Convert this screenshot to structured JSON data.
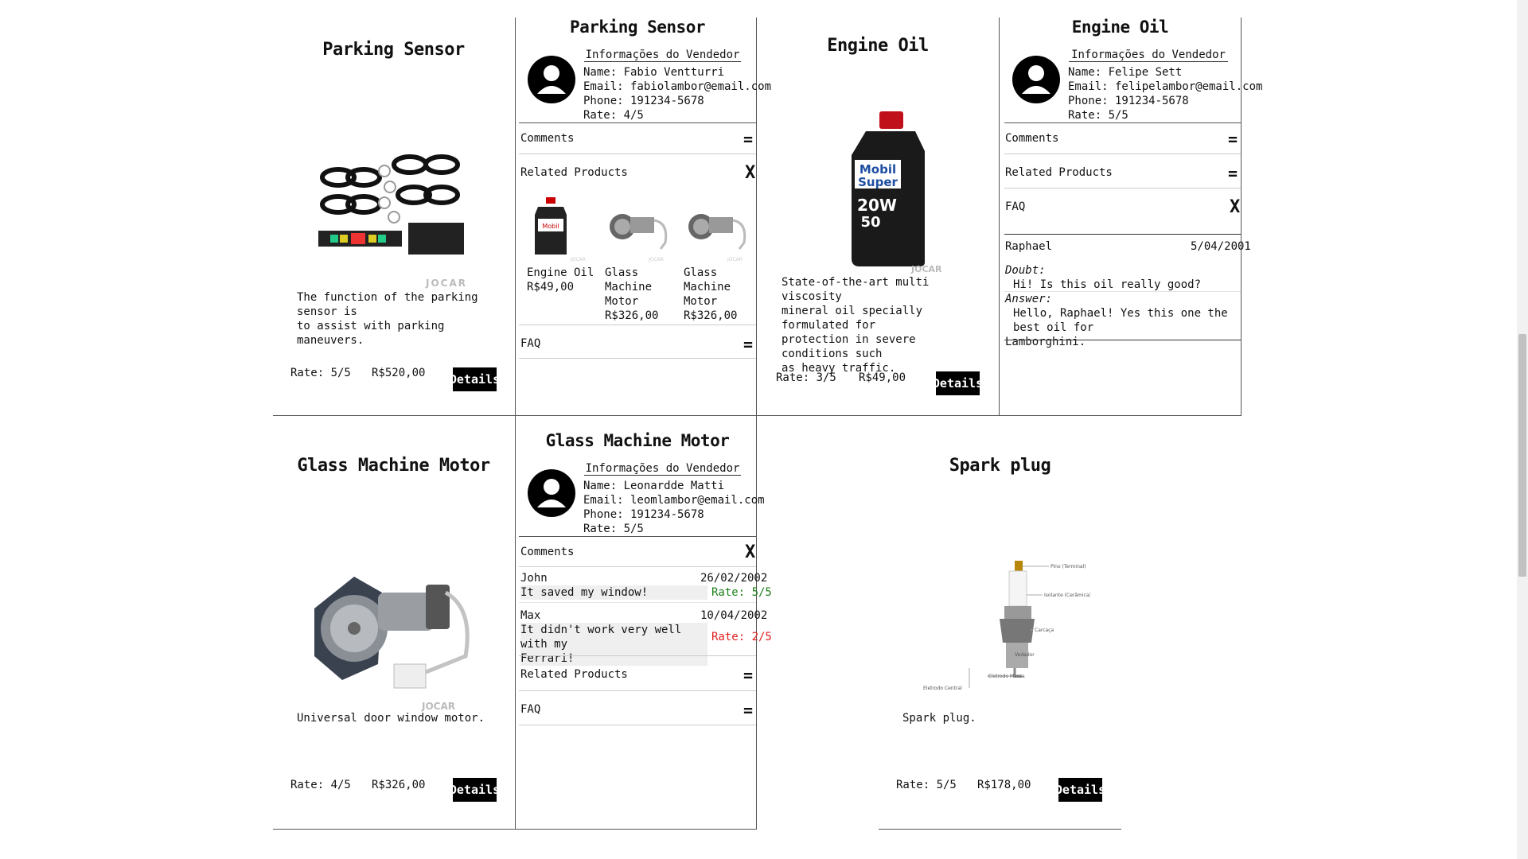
{
  "row1": {
    "col1": {
      "title": "Parking Sensor",
      "description_l1": "The function of the parking sensor is",
      "description_l2": "to assist with parking maneuvers.",
      "rate": "Rate: 5/5",
      "price": "R$520,00",
      "details_label": "Details"
    },
    "col2": {
      "title": "Parking Sensor",
      "vendor_heading": "Informações do Vendedor",
      "vendor_name": "Name: Fabio Ventturri",
      "vendor_email": "Email: fabiolambor@email.com",
      "vendor_phone": "Phone: 191234-5678",
      "vendor_rate": "Rate: 4/5",
      "comments_label": "Comments",
      "related_label": "Related Products",
      "faq_label": "FAQ",
      "related": [
        {
          "name_l1": "Engine Oil",
          "name_l2": "",
          "name_l3": "",
          "price": "R$49,00"
        },
        {
          "name_l1": "Glass",
          "name_l2": "Machine",
          "name_l3": "Motor",
          "price": "R$326,00"
        },
        {
          "name_l1": "Glass",
          "name_l2": "Machine",
          "name_l3": "Motor",
          "price": "R$326,00"
        }
      ]
    },
    "col3": {
      "title": "Engine Oil",
      "description_l1": "State-of-the-art multi viscosity",
      "description_l2": "mineral oil specially formulated for",
      "description_l3": "protection in severe conditions such",
      "description_l4": "as heavy traffic.",
      "rate": "Rate: 3/5",
      "price": "R$49,00",
      "details_label": "Details"
    },
    "col4": {
      "title": "Engine Oil",
      "vendor_heading": "Informações do Vendedor",
      "vendor_name": "Name: Felipe Sett",
      "vendor_email": "Email: felipelambor@email.com",
      "vendor_phone": "Phone: 191234-5678",
      "vendor_rate": "Rate: 5/5",
      "comments_label": "Comments",
      "related_label": "Related Products",
      "faq_label": "FAQ",
      "faq": {
        "author": "Raphael",
        "date": "5/04/2001",
        "doubt_label": "Doubt:",
        "doubt": "Hi! Is this oil really good?",
        "answer_label": "Answer:",
        "answer_l1": "Hello, Raphael! Yes this one the best oil for",
        "answer_l2": "Lamborghini."
      }
    }
  },
  "row2": {
    "col1": {
      "title": "Glass Machine Motor",
      "description": "Universal door window motor.",
      "rate": "Rate: 4/5",
      "price": "R$326,00",
      "details_label": "Details"
    },
    "col2": {
      "title": "Glass Machine Motor",
      "vendor_heading": "Informações do Vendedor",
      "vendor_name": "Name: Leonardde Matti",
      "vendor_email": "Email: leomlambor@email.com",
      "vendor_phone": "Phone: 191234-5678",
      "vendor_rate": "Rate: 5/5",
      "comments_label": "Comments",
      "related_label": "Related Products",
      "faq_label": "FAQ",
      "comments": [
        {
          "author": "John",
          "date": "26/02/2002",
          "text_l1": "It saved my window!",
          "text_l2": "",
          "rate": "Rate: 5/5"
        },
        {
          "author": "Max",
          "date": "10/04/2002",
          "text_l1": "It didn't work very well with my",
          "text_l2": "Ferrari!",
          "rate": "Rate: 2/5"
        }
      ]
    },
    "col3": {
      "title": "Spark plug",
      "description": "Spark plug.",
      "rate": "Rate: 5/5",
      "price": "R$178,00",
      "details_label": "Details",
      "diagram_labels": [
        "Pino (Terminal)",
        "Isolante (Cerâmica)",
        "Carcaça",
        "Vedador",
        "Eletrodo Massa",
        "Eletrodo Central"
      ]
    }
  },
  "watermark": "JOCAR",
  "colors": {
    "good_rate": "#1a7f1a",
    "bad_rate": "#e0201e",
    "button_bg": "#000000"
  }
}
